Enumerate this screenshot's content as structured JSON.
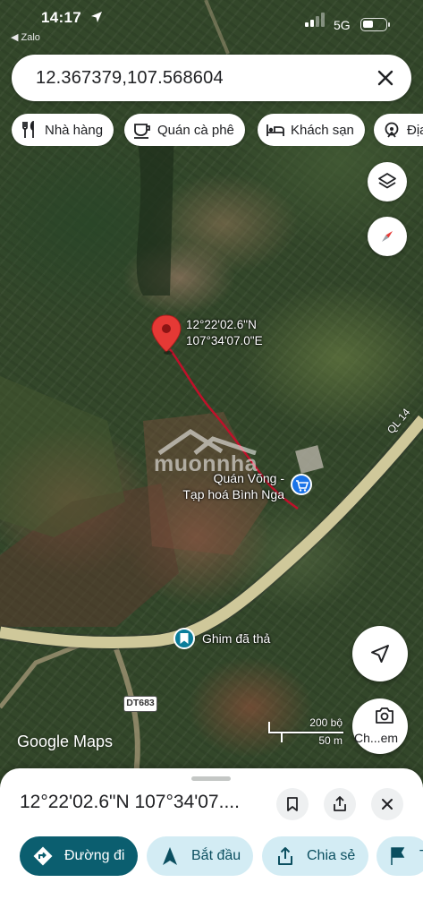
{
  "status_bar": {
    "time": "14:17",
    "back_app": "◀ Zalo",
    "network": "5G",
    "battery_level": 0.45
  },
  "search": {
    "query": "12.367379,107.568604"
  },
  "chips": [
    {
      "label": "Nhà hàng",
      "icon": "fork-knife-icon"
    },
    {
      "label": "Quán cà phê",
      "icon": "coffee-cup-icon"
    },
    {
      "label": "Khách sạn",
      "icon": "bed-icon"
    },
    {
      "label": "Địa",
      "icon": "attraction-icon"
    }
  ],
  "map": {
    "pin": {
      "lat_label": "12°22'02.6\"N",
      "lng_label": "107°34'07.0\"E"
    },
    "poi_shop": {
      "line1": "Quán Võng -",
      "line2": "Tạp hoá Bình Nga"
    },
    "dropped_pin_label": "Ghim đã thả",
    "road_label": "QL 14",
    "route_shield": "DT683",
    "watermark": "muonnha",
    "google_logo": "Google Maps",
    "scale": {
      "top": "200 bộ",
      "bottom": "50 m"
    },
    "shortcut_label": "Ch...em"
  },
  "sheet": {
    "title": "12°22'02.6\"N 107°34'07....",
    "actions": [
      {
        "label": "Đường đi",
        "icon": "directions-icon"
      },
      {
        "label": "Bắt đầu",
        "icon": "navigation-icon"
      },
      {
        "label": "Chia sẻ",
        "icon": "share-icon"
      },
      {
        "label": "T",
        "icon": "flag-icon"
      }
    ]
  },
  "colors": {
    "pin_red": "#e53935",
    "route_red": "#c0102a",
    "primary_teal": "#0b5e6f",
    "secondary_bg": "#d3ecf4",
    "poi_blue": "#1a73e8",
    "road": "#cfc89a"
  }
}
